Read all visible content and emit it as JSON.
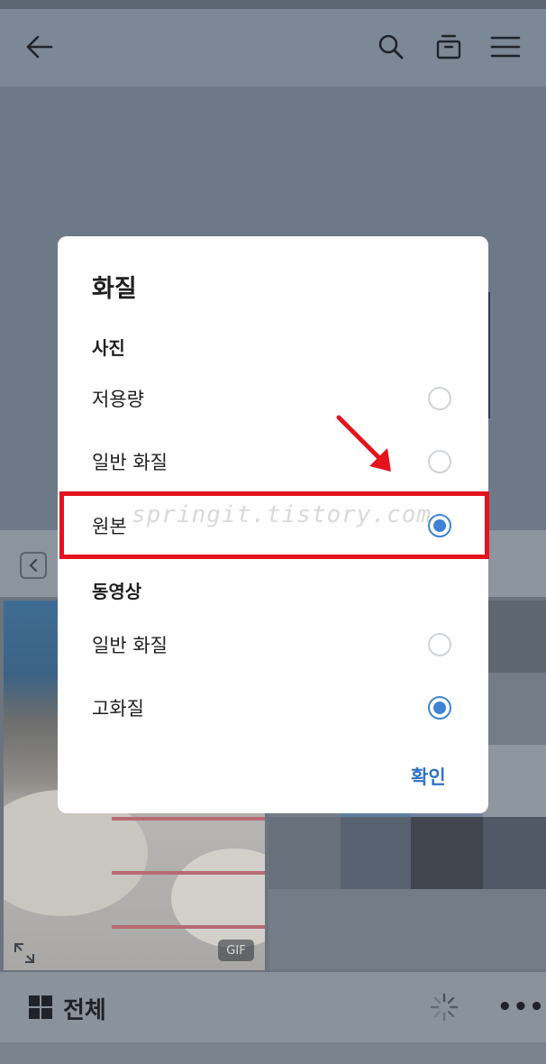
{
  "app": {
    "topbar": {
      "back_icon": "arrow-left-icon",
      "search_icon": "search-icon",
      "archive_icon": "archive-box-icon",
      "menu_icon": "hamburger-menu-icon"
    },
    "grid": {
      "gif_badge": "GIF",
      "expand_icon": "expand-icon"
    },
    "bottombar": {
      "view_label": "전체",
      "grid_icon": "grid-icon",
      "loading_icon": "spinner-icon",
      "more_label": "•••"
    }
  },
  "dialog": {
    "title": "화질",
    "photo_section": {
      "heading": "사진",
      "options": [
        {
          "label": "저용량",
          "selected": false
        },
        {
          "label": "일반 화질",
          "selected": false
        },
        {
          "label": "원본",
          "selected": true
        }
      ]
    },
    "video_section": {
      "heading": "동영상",
      "options": [
        {
          "label": "일반 화질",
          "selected": false
        },
        {
          "label": "고화질",
          "selected": true
        }
      ]
    },
    "confirm_label": "확인"
  },
  "annotation": {
    "watermark": "springit.tistory.com",
    "highlight_color": "#e3141e",
    "accent_color": "#3d84d6"
  }
}
